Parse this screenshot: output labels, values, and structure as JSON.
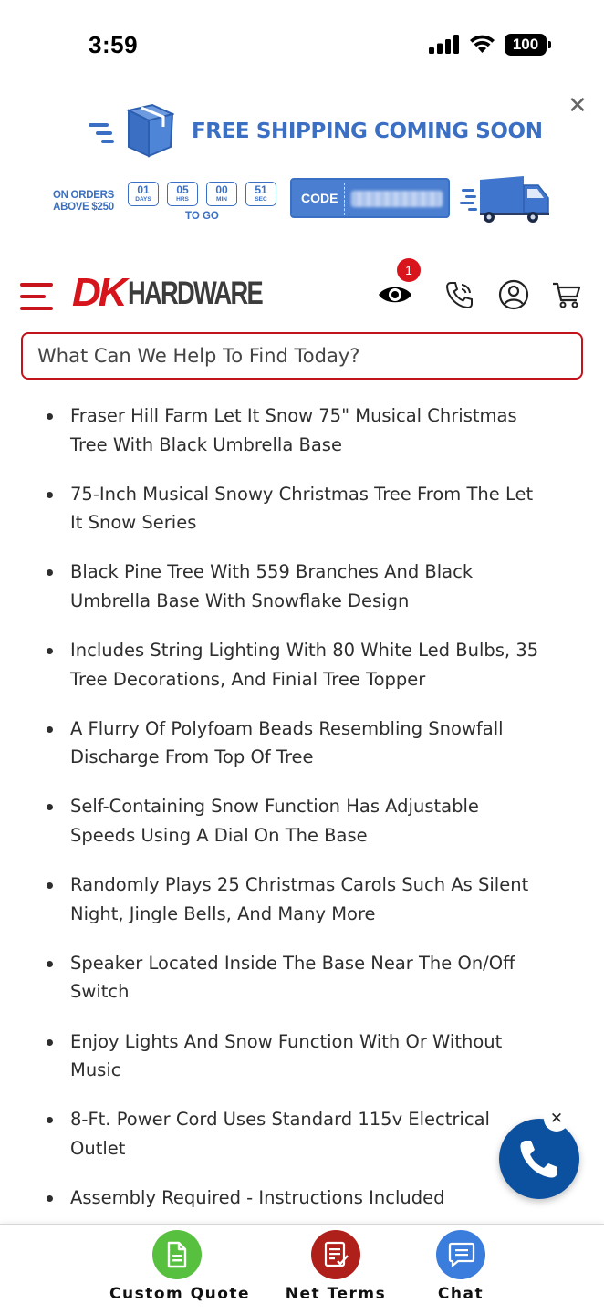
{
  "status_bar": {
    "time": "3:59",
    "battery": "100"
  },
  "promo": {
    "headline": "FREE SHIPPING COMING SOON",
    "orders_line1": "ON ORDERS",
    "orders_line2": "ABOVE $250",
    "countdown": [
      {
        "value": "01",
        "unit": "DAYS"
      },
      {
        "value": "05",
        "unit": "HRS"
      },
      {
        "value": "00",
        "unit": "MIN"
      },
      {
        "value": "51",
        "unit": "SEC"
      }
    ],
    "to_go": "TO GO",
    "code_label": "CODE",
    "close_symbol": "✕"
  },
  "header": {
    "logo_dk": "DK",
    "logo_hardware": "HARDWARE",
    "eye_badge_count": "1",
    "icons": [
      "menu-icon",
      "eye-icon",
      "phone-icon",
      "user-icon",
      "cart-icon"
    ]
  },
  "search": {
    "placeholder": "What Can We Help To Find Today?"
  },
  "features": [
    "Fraser Hill Farm Let It Snow 75\" Musical Christmas Tree With Black Umbrella Base",
    "75-Inch Musical Snowy Christmas Tree From The Let It Snow Series",
    "Black Pine Tree With 559 Branches And Black Umbrella Base With Snowflake Design",
    "Includes String Lighting With 80 White Led Bulbs, 35 Tree Decorations, And Finial Tree Topper",
    "A Flurry Of Polyfoam Beads Resembling Snowfall Discharge From Top Of Tree",
    "Self-Containing Snow Function Has Adjustable Speeds Using A Dial On The Base",
    "Randomly Plays 25 Christmas Carols Such As Silent Night, Jingle Bells, And Many More",
    "Speaker Located Inside The Base Near The On/Off Switch",
    "Enjoy Lights And Snow Function With Or Without Music",
    "8-Ft. Power Cord Uses Standard 115v Electrical Outlet",
    "Assembly Required - Instructions Included"
  ],
  "call_widget": {
    "close_symbol": "✕"
  },
  "bottom_bar": {
    "custom_quote": "Custom Quote",
    "net_terms": "Net Terms",
    "chat": "Chat"
  },
  "colors": {
    "brand_red": "#d6141c",
    "promo_blue": "#3a6fc4",
    "call_blue": "#0c50a0",
    "quote_green": "#57c03e",
    "terms_red": "#b0201b",
    "chat_blue": "#3b7ddc"
  }
}
